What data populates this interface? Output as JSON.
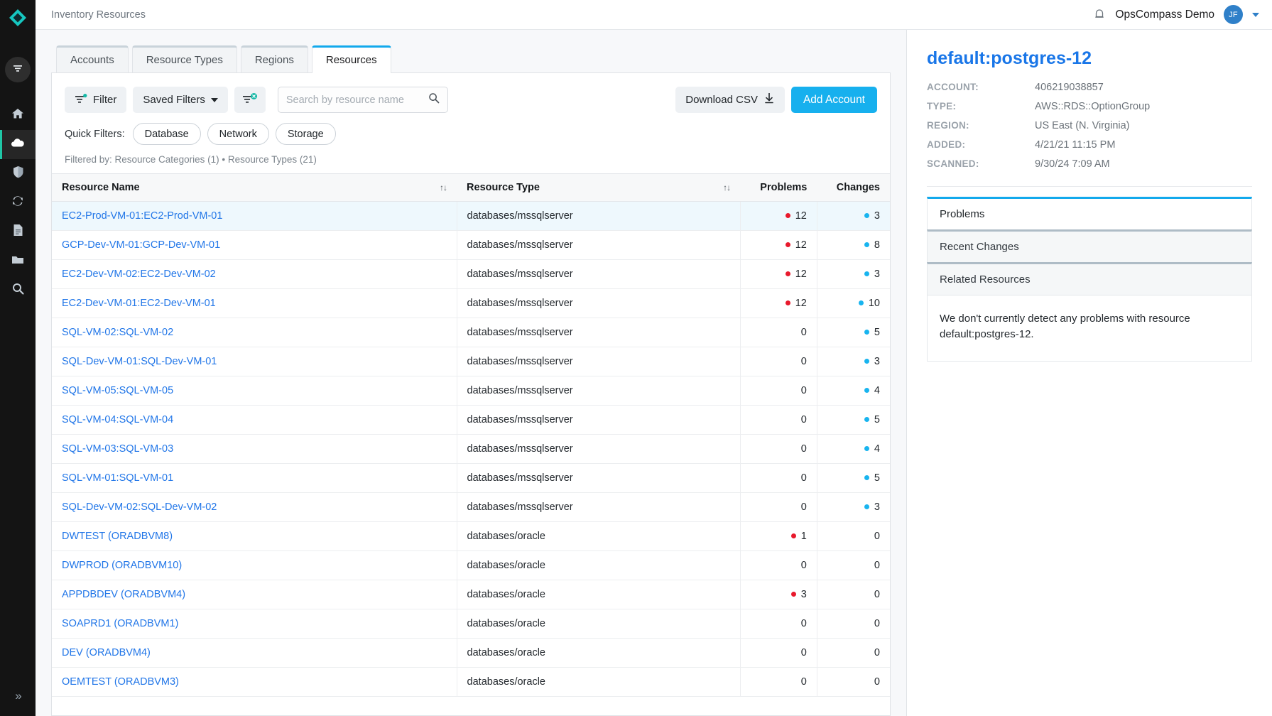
{
  "sidebar": {
    "logo": "opscompass-logo",
    "filter_toggle": "filter-toggle",
    "items": [
      {
        "name": "home",
        "icon": "home-icon",
        "active": false
      },
      {
        "name": "cloud",
        "icon": "cloud-icon",
        "active": true
      },
      {
        "name": "security",
        "icon": "shield-icon",
        "active": false
      },
      {
        "name": "drift",
        "icon": "sync-icon",
        "active": false
      },
      {
        "name": "reports",
        "icon": "document-icon",
        "active": false
      },
      {
        "name": "files",
        "icon": "folder-icon",
        "active": false
      },
      {
        "name": "search",
        "icon": "search-icon",
        "active": false
      }
    ],
    "expand_label": "»"
  },
  "topbar": {
    "breadcrumb": "Inventory Resources",
    "bell_icon": "bell-icon",
    "org_name": "OpsCompass Demo",
    "avatar_initials": "JF",
    "caret_icon": "chevron-down-icon"
  },
  "tabs": [
    {
      "label": "Accounts",
      "active": false
    },
    {
      "label": "Resource Types",
      "active": false
    },
    {
      "label": "Regions",
      "active": false
    },
    {
      "label": "Resources",
      "active": true
    }
  ],
  "toolbar": {
    "filter_label": "Filter",
    "saved_filters_label": "Saved Filters",
    "clear_filter_icon": "clear-filter-icon",
    "search_placeholder": "Search by resource name",
    "search_value": "",
    "search_icon": "search-icon",
    "download_csv_label": "Download CSV",
    "download_icon": "download-icon",
    "add_account_label": "Add Account"
  },
  "quick_filters": {
    "label": "Quick Filters:",
    "chips": [
      "Database",
      "Network",
      "Storage"
    ]
  },
  "filtered_by": "Filtered by: Resource Categories (1) • Resource Types (21)",
  "table": {
    "columns": [
      "Resource Name",
      "Resource Type",
      "Problems",
      "Changes"
    ],
    "sort_icon": "sort-icon",
    "rows": [
      {
        "name": "EC2-Prod-VM-01:EC2-Prod-VM-01",
        "type": "databases/mssqlserver",
        "problems": 12,
        "changes": 3,
        "highlight": true
      },
      {
        "name": "GCP-Dev-VM-01:GCP-Dev-VM-01",
        "type": "databases/mssqlserver",
        "problems": 12,
        "changes": 8,
        "highlight": false
      },
      {
        "name": "EC2-Dev-VM-02:EC2-Dev-VM-02",
        "type": "databases/mssqlserver",
        "problems": 12,
        "changes": 3,
        "highlight": false
      },
      {
        "name": "EC2-Dev-VM-01:EC2-Dev-VM-01",
        "type": "databases/mssqlserver",
        "problems": 12,
        "changes": 10,
        "highlight": false
      },
      {
        "name": "SQL-VM-02:SQL-VM-02",
        "type": "databases/mssqlserver",
        "problems": 0,
        "changes": 5,
        "highlight": false
      },
      {
        "name": "SQL-Dev-VM-01:SQL-Dev-VM-01",
        "type": "databases/mssqlserver",
        "problems": 0,
        "changes": 3,
        "highlight": false
      },
      {
        "name": "SQL-VM-05:SQL-VM-05",
        "type": "databases/mssqlserver",
        "problems": 0,
        "changes": 4,
        "highlight": false
      },
      {
        "name": "SQL-VM-04:SQL-VM-04",
        "type": "databases/mssqlserver",
        "problems": 0,
        "changes": 5,
        "highlight": false
      },
      {
        "name": "SQL-VM-03:SQL-VM-03",
        "type": "databases/mssqlserver",
        "problems": 0,
        "changes": 4,
        "highlight": false
      },
      {
        "name": "SQL-VM-01:SQL-VM-01",
        "type": "databases/mssqlserver",
        "problems": 0,
        "changes": 5,
        "highlight": false
      },
      {
        "name": "SQL-Dev-VM-02:SQL-Dev-VM-02",
        "type": "databases/mssqlserver",
        "problems": 0,
        "changes": 3,
        "highlight": false
      },
      {
        "name": "DWTEST (ORADBVM8)",
        "type": "databases/oracle",
        "problems": 1,
        "changes": 0,
        "highlight": false
      },
      {
        "name": "DWPROD (ORADBVM10)",
        "type": "databases/oracle",
        "problems": 0,
        "changes": 0,
        "highlight": false
      },
      {
        "name": "APPDBDEV (ORADBVM4)",
        "type": "databases/oracle",
        "problems": 3,
        "changes": 0,
        "highlight": false
      },
      {
        "name": "SOAPRD1 (ORADBVM1)",
        "type": "databases/oracle",
        "problems": 0,
        "changes": 0,
        "highlight": false
      },
      {
        "name": "DEV (ORADBVM4)",
        "type": "databases/oracle",
        "problems": 0,
        "changes": 0,
        "highlight": false
      },
      {
        "name": "OEMTEST (ORADBVM3)",
        "type": "databases/oracle",
        "problems": 0,
        "changes": 0,
        "highlight": false
      }
    ]
  },
  "detail": {
    "title": "default:postgres-12",
    "meta": [
      {
        "key": "ACCOUNT:",
        "value": "406219038857"
      },
      {
        "key": "TYPE:",
        "value": "AWS::RDS::OptionGroup"
      },
      {
        "key": "REGION:",
        "value": "US East (N. Virginia)"
      },
      {
        "key": "ADDED:",
        "value": "4/21/21 11:15 PM"
      },
      {
        "key": "SCANNED:",
        "value": "9/30/24 7:09 AM"
      }
    ],
    "accordions": [
      {
        "label": "Problems",
        "active": true
      },
      {
        "label": "Recent Changes",
        "active": false
      },
      {
        "label": "Related Resources",
        "active": false
      }
    ],
    "body_text": "We don't currently detect any problems with resource default:postgres-12."
  },
  "colors": {
    "accent_blue": "#17b0ee",
    "link_blue": "#2176e8",
    "teal": "#14b8a6",
    "problem_red": "#e8192c",
    "change_blue": "#18b4ef"
  }
}
